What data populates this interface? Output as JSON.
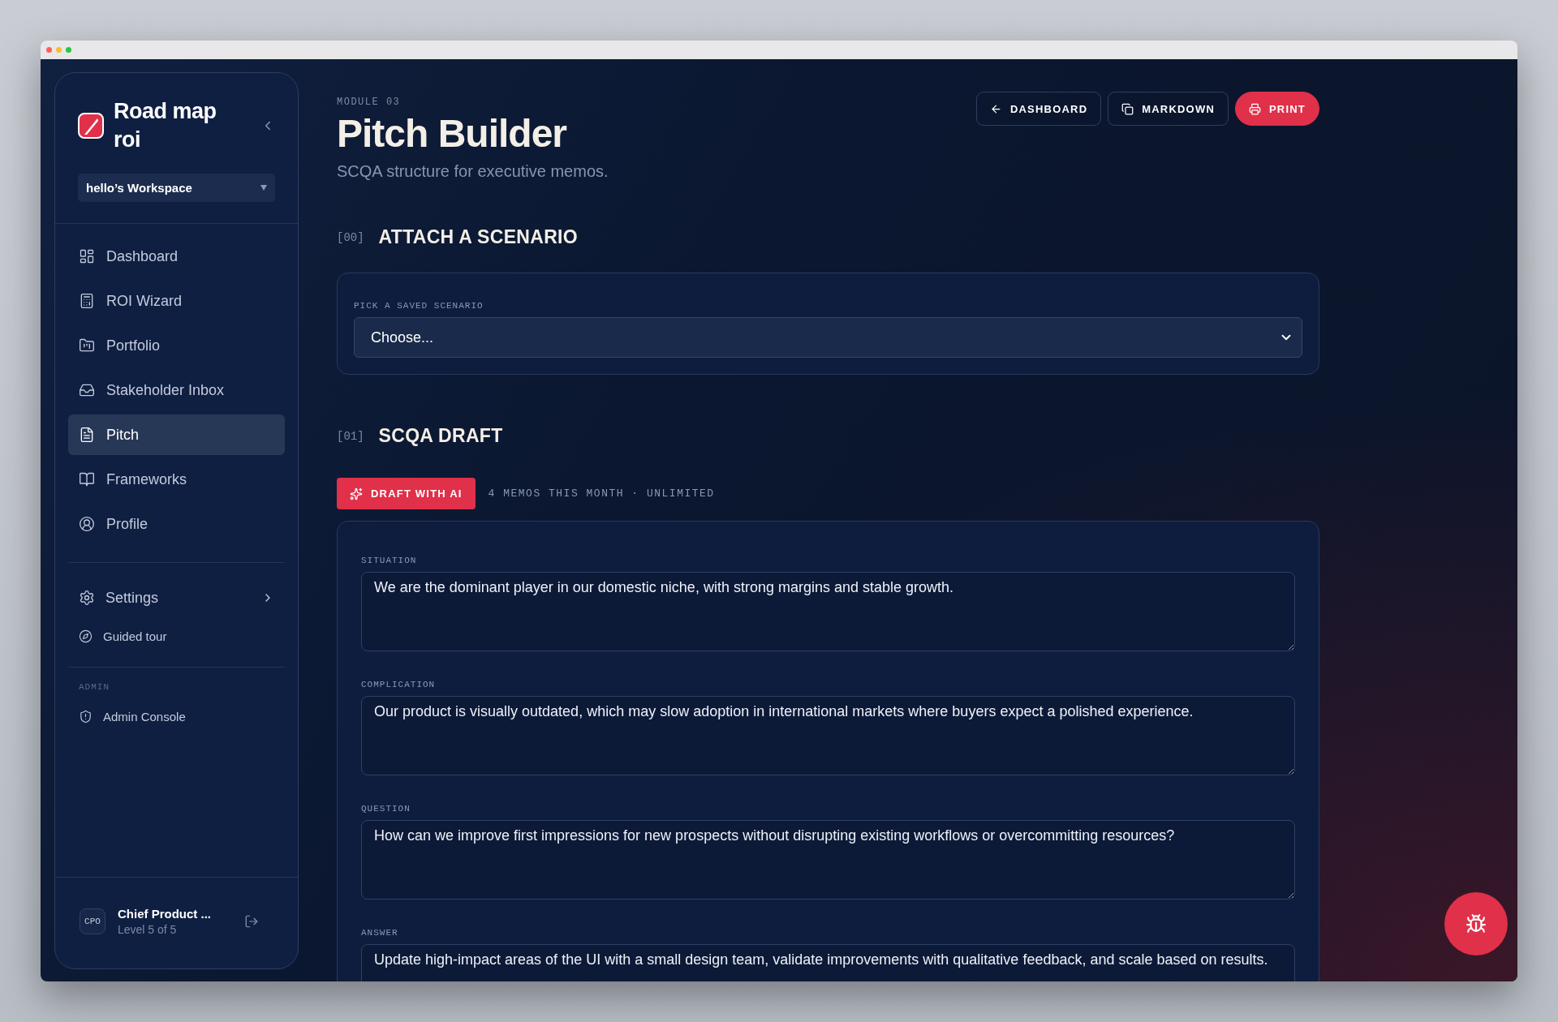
{
  "sidebar": {
    "brand": "Road map roi",
    "workspace": "hello’s Workspace",
    "nav": [
      {
        "label": "Dashboard",
        "selected": false
      },
      {
        "label": "ROI Wizard",
        "selected": false
      },
      {
        "label": "Portfolio",
        "selected": false
      },
      {
        "label": "Stakeholder Inbox",
        "selected": false
      },
      {
        "label": "Pitch",
        "selected": true
      },
      {
        "label": "Frameworks",
        "selected": false
      },
      {
        "label": "Profile",
        "selected": false
      }
    ],
    "secondary": [
      {
        "label": "Settings",
        "kind": "submenu"
      },
      {
        "label": "Guided tour",
        "kind": "link"
      }
    ],
    "admin": {
      "heading": "ADMIN",
      "items": [
        {
          "label": "Admin Console"
        }
      ]
    },
    "user": {
      "initials": "CPO",
      "name": "Chief Product ...",
      "level": "Level 5 of 5"
    }
  },
  "header": {
    "eyebrow": "MODULE 03",
    "title": "Pitch Builder",
    "subtitle": "SCQA structure for executive memos.",
    "actions": [
      {
        "label": "DASHBOARD",
        "kind": "outline"
      },
      {
        "label": "MARKDOWN",
        "kind": "outline"
      },
      {
        "label": "PRINT",
        "kind": "primary"
      }
    ]
  },
  "scenario": {
    "index": "[00]",
    "title": "ATTACH A SCENARIO",
    "field_label": "PICK A SAVED SCENARIO",
    "value": "Choose..."
  },
  "draft": {
    "index": "[01]",
    "title": "SCQA DRAFT",
    "ai_button": "DRAFT WITH AI",
    "usage": "4 MEMOS THIS MONTH · UNLIMITED",
    "fields": [
      {
        "label": "SITUATION",
        "value": "We are the dominant player in our domestic niche, with strong margins and stable growth."
      },
      {
        "label": "COMPLICATION",
        "value": "Our product is visually outdated, which may slow adoption in international markets where buyers expect a polished experience."
      },
      {
        "label": "QUESTION",
        "value": "How can we improve first impressions for new prospects without disrupting existing workflows or overcommitting resources?"
      },
      {
        "label": "ANSWER",
        "value": "Update high-impact areas of the UI with a small design team, validate improvements with qualitative feedback, and scale based on results."
      }
    ]
  }
}
